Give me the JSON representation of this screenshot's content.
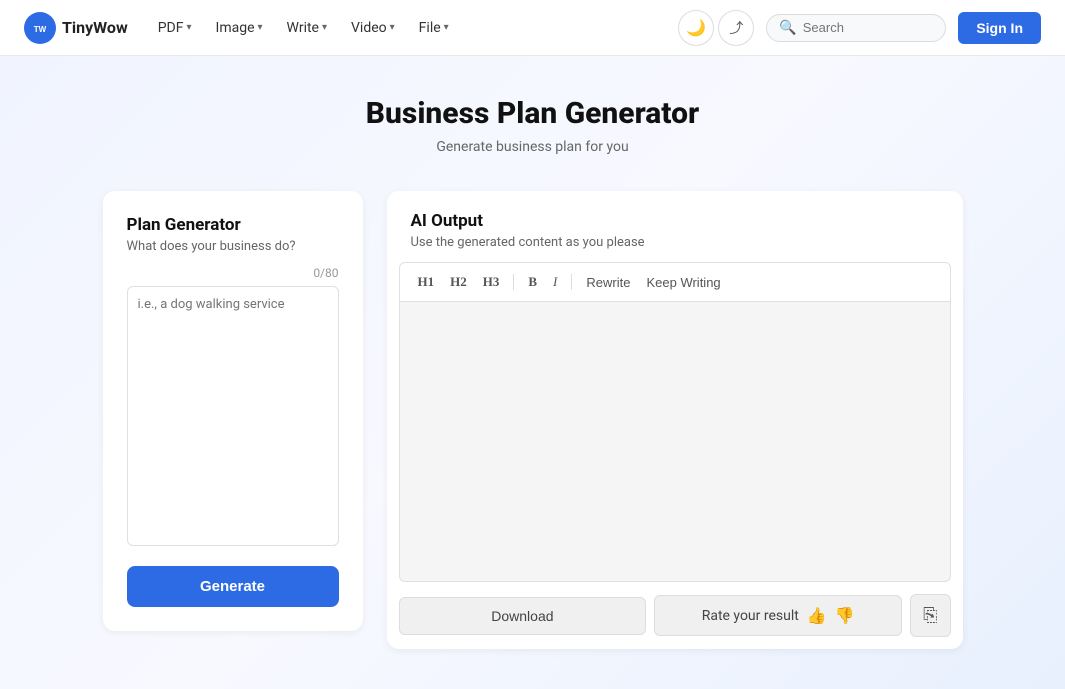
{
  "logo": {
    "icon_text": "TW",
    "name": "TinyWow"
  },
  "navbar": {
    "items": [
      {
        "label": "PDF",
        "has_arrow": true
      },
      {
        "label": "Image",
        "has_arrow": true
      },
      {
        "label": "Write",
        "has_arrow": true
      },
      {
        "label": "Video",
        "has_arrow": true
      },
      {
        "label": "File",
        "has_arrow": true
      }
    ],
    "dark_mode_icon": "🌙",
    "share_icon": "⇪",
    "search_placeholder": "Search",
    "sign_in_label": "Sign In"
  },
  "page": {
    "title": "Business Plan Generator",
    "subtitle": "Generate business plan for you"
  },
  "left_panel": {
    "title": "Plan Generator",
    "subtitle": "What does your business do?",
    "char_count": "0/80",
    "textarea_placeholder": "i.e., a dog walking service",
    "generate_label": "Generate"
  },
  "right_panel": {
    "title": "AI Output",
    "subtitle": "Use the generated content as you please",
    "toolbar": {
      "h1": "H1",
      "h2": "H2",
      "h3": "H3",
      "bold": "B",
      "italic": "I",
      "rewrite": "Rewrite",
      "keep_writing": "Keep Writing"
    },
    "download_label": "Download",
    "rate_label": "Rate your result",
    "thumbs_up": "👍",
    "thumbs_down": "👎",
    "copy_icon": "⎘"
  }
}
